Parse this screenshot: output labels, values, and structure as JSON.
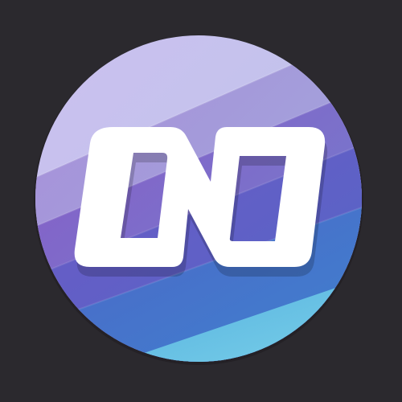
{
  "app_icon": {
    "icon_name": "nd-monogram-logo-icon",
    "background_color": "#2b292e",
    "badge_gradient": [
      "#c6b8e6",
      "#a98fd6",
      "#7f5fbf",
      "#4e5bc2",
      "#3f8bd0",
      "#79d3e6"
    ],
    "glyph_color": "#ffffff",
    "monogram_text": "ND"
  }
}
